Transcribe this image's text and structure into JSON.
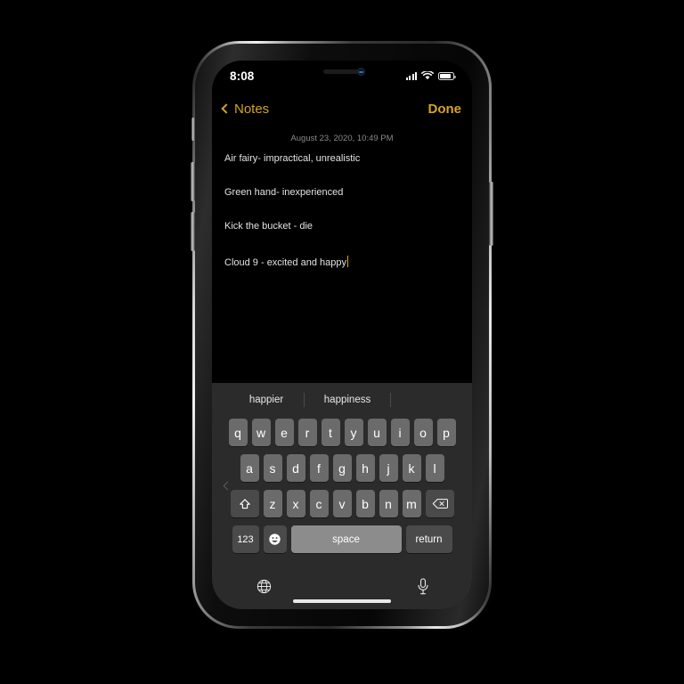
{
  "status_bar": {
    "time": "8:08",
    "cellular_icon": "cellular-signal-icon",
    "wifi_icon": "wifi-icon",
    "battery_icon": "battery-icon"
  },
  "nav": {
    "back_label": "Notes",
    "back_icon": "chevron-left-icon",
    "done_label": "Done",
    "accent_color": "#D6A323"
  },
  "note": {
    "date": "August 23, 2020, 10:49 PM",
    "lines": [
      "Air fairy- impractical, unrealistic",
      "Green hand- inexperienced",
      "Kick the bucket - die",
      "Cloud 9 - excited and happy"
    ],
    "caret_color": "#D6A323"
  },
  "keyboard": {
    "suggestions": [
      "happier",
      "happiness",
      ""
    ],
    "row1": [
      "q",
      "w",
      "e",
      "r",
      "t",
      "y",
      "u",
      "i",
      "o",
      "p"
    ],
    "row2": [
      "a",
      "s",
      "d",
      "f",
      "g",
      "h",
      "j",
      "k",
      "l"
    ],
    "row3_letters": [
      "z",
      "x",
      "c",
      "v",
      "b",
      "n",
      "m"
    ],
    "shift_icon": "shift-arrow-icon",
    "delete_icon": "backspace-delete-icon",
    "numeric_label": "123",
    "emoji_icon": "emoji-smiley-icon",
    "space_label": "space",
    "return_label": "return",
    "globe_icon": "globe-language-icon",
    "mic_icon": "microphone-icon",
    "key_color": "#6b6b6b",
    "function_key_color": "#4a4a4a",
    "space_key_color": "#8c8c8c",
    "background_color": "#2b2b2b"
  }
}
